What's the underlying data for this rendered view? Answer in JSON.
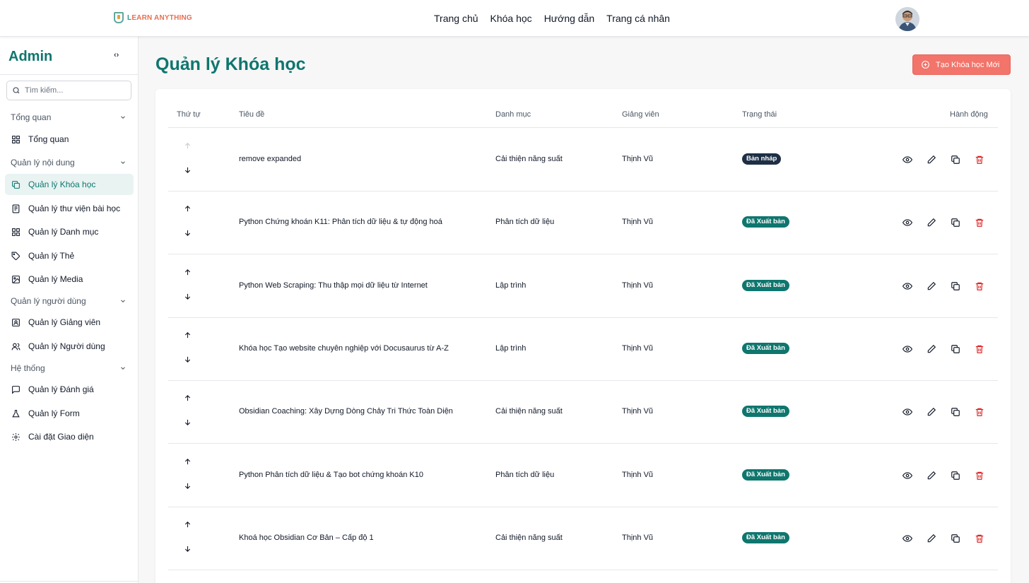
{
  "brand": {
    "logo_prefix": "L",
    "logo_rest": "EARN ANYTHING"
  },
  "topnav": [
    "Trang chủ",
    "Khóa học",
    "Hướng dẫn",
    "Trang cá nhân"
  ],
  "sidebar": {
    "title": "Admin",
    "search_placeholder": "Tìm kiếm...",
    "groups": {
      "overview": "Tổng quan",
      "content": "Quản lý nội dung",
      "users": "Quản lý người dùng",
      "system": "Hệ thống"
    },
    "items": [
      {
        "label": "Tổng quan",
        "icon": "dashboard-icon"
      },
      {
        "label": "Quản lý Khóa học",
        "icon": "copy-icon",
        "active": true
      },
      {
        "label": "Quản lý thư viện bài học",
        "icon": "book-icon"
      },
      {
        "label": "Quản lý Danh mục",
        "icon": "grid-icon"
      },
      {
        "label": "Quản lý Thẻ",
        "icon": "tag-icon"
      },
      {
        "label": "Quản lý Media",
        "icon": "image-icon"
      },
      {
        "label": "Quản lý Giảng viên",
        "icon": "contact-icon"
      },
      {
        "label": "Quản lý Người dùng",
        "icon": "users-icon"
      },
      {
        "label": "Quản lý Đánh giá",
        "icon": "message-icon"
      },
      {
        "label": "Quản lý Form",
        "icon": "flask-icon"
      },
      {
        "label": "Cài đặt Giao diện",
        "icon": "gear-icon"
      }
    ]
  },
  "page": {
    "title": "Quản lý Khóa học",
    "create_label": "Tạo Khóa học Mới"
  },
  "table": {
    "headers": {
      "order": "Thứ tự",
      "title": "Tiêu đề",
      "category": "Danh mục",
      "instructor": "Giảng viên",
      "status": "Trạng thái",
      "actions": "Hành động"
    },
    "rows": [
      {
        "title": "remove expanded",
        "category": "Cải thiện năng suất",
        "instructor": "Thịnh Vũ",
        "status": "Bản nháp",
        "status_type": "draft"
      },
      {
        "title": "Python Chứng khoán K11: Phân tích dữ liệu & tự động hoá",
        "category": "Phân tích dữ liệu",
        "instructor": "Thịnh Vũ",
        "status": "Đã Xuất bản",
        "status_type": "published"
      },
      {
        "title": "Python Web Scraping: Thu thập mọi dữ liệu từ Internet",
        "category": "Lập trình",
        "instructor": "Thịnh Vũ",
        "status": "Đã Xuất bản",
        "status_type": "published"
      },
      {
        "title": "Khóa học Tạo website chuyên nghiệp với Docusaurus từ A-Z",
        "category": "Lập trình",
        "instructor": "Thịnh Vũ",
        "status": "Đã Xuất bản",
        "status_type": "published"
      },
      {
        "title": "Obsidian Coaching: Xây Dựng Dòng Chảy Tri Thức Toàn Diện",
        "category": "Cải thiện năng suất",
        "instructor": "Thịnh Vũ",
        "status": "Đã Xuất bản",
        "status_type": "published"
      },
      {
        "title": "Python Phân tích dữ liệu & Tạo bot chứng khoán K10",
        "category": "Phân tích dữ liệu",
        "instructor": "Thịnh Vũ",
        "status": "Đã Xuất bản",
        "status_type": "published"
      },
      {
        "title": "Khoá học Obsidian Cơ Bản – Cấp độ 1",
        "category": "Cải thiện năng suất",
        "instructor": "Thịnh Vũ",
        "status": "Đã Xuất bản",
        "status_type": "published"
      }
    ]
  },
  "colors": {
    "accent": "#0f766e",
    "create_button": "#f2746a",
    "delete": "#dc2626",
    "draft_badge": "#1e2f45"
  }
}
